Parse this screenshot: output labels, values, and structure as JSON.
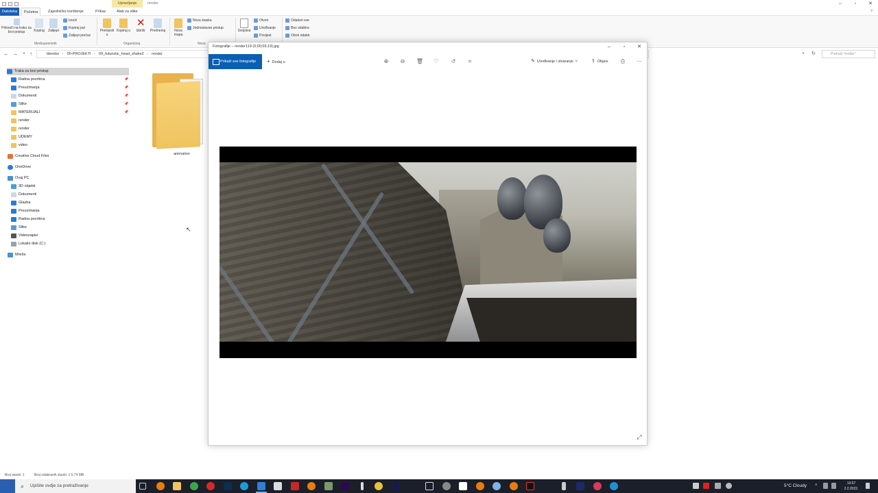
{
  "explorer": {
    "title_tabs": {
      "manage": "Upravljanje",
      "folder": "render"
    },
    "ribbon_tabs": [
      "Datoteka",
      "Početna",
      "Zajedničko korištenje",
      "Prikaz",
      "Alati za slike"
    ],
    "ribbon": {
      "pin": "Prikvači na traku za brzi pristup",
      "copy": "Kopiraj",
      "paste": "Zalijepi",
      "cut": "Izreži",
      "copy_path": "Kopiraj put",
      "paste_shortcut": "Zalijepi prečac",
      "group_clipboard": "Međuspremnik",
      "move_to": "Premjesti u",
      "copy_to": "Kopiraj u",
      "delete": "Izbriši",
      "rename": "Preimenuj",
      "group_organize": "Organiziraj",
      "new_folder": "Nova mapa",
      "new_item": "Nova stavka",
      "easy_access": "Jednostavan pristup",
      "group_new": "Nova",
      "properties": "Svojstva",
      "open": "Otvori",
      "edit": "Uređivanje",
      "history": "Povijest",
      "select_all": "Odaberi sve",
      "select_none": "Bez odabira",
      "invert": "Obrni odabir"
    },
    "breadcrumb": [
      "blender",
      "00-PROJEKTI",
      "09_futuristic_head_shake2",
      "render"
    ],
    "search_placeholder": "Pretraži \"render\"",
    "nav": {
      "quick_access": "Traka za brzi pristup",
      "items": [
        "Radna površina",
        "Preuzimanja",
        "Dokumenti",
        "Slike",
        "MATERIJALI",
        "render",
        "render",
        "UDEMY",
        "video"
      ],
      "creative_cloud": "Creative Cloud Files",
      "onedrive": "OneDrive",
      "this_pc": "Ovaj PC",
      "pc_items": [
        "3D objekti",
        "Dokumenti",
        "Glazba",
        "Preuzimanja",
        "Radna površina",
        "Slike",
        "Videozapisi",
        "Lokalni disk (C:)"
      ],
      "network": "Mreža"
    },
    "content": {
      "folder_name": "animation"
    },
    "status": {
      "items": "Broj stavki: 1",
      "selected": "Broj odabranih stavki: 1  5,74 MB"
    }
  },
  "photos": {
    "title": "Fotografije – render119 (0;00;03;19).jpg",
    "see_all": "Prikaži sve fotografije",
    "add_to": "Dodaj u",
    "edit_create": "Uređivanje i stvaranje",
    "share": "Objavi",
    "tools": [
      "zoom-in-icon",
      "zoom-out-icon",
      "delete-icon",
      "favorite-icon",
      "rotate-icon",
      "crop-icon"
    ]
  },
  "taskbar": {
    "search_placeholder": "Upišite ovdje za pretraživanje",
    "weather": "5°C  Cloudy",
    "time": "13:57",
    "date": "2.2.2022."
  },
  "colors": {
    "accent": "#0a5fb4",
    "taskbar": "#1b1f2a",
    "folder": "#f0c45e"
  }
}
